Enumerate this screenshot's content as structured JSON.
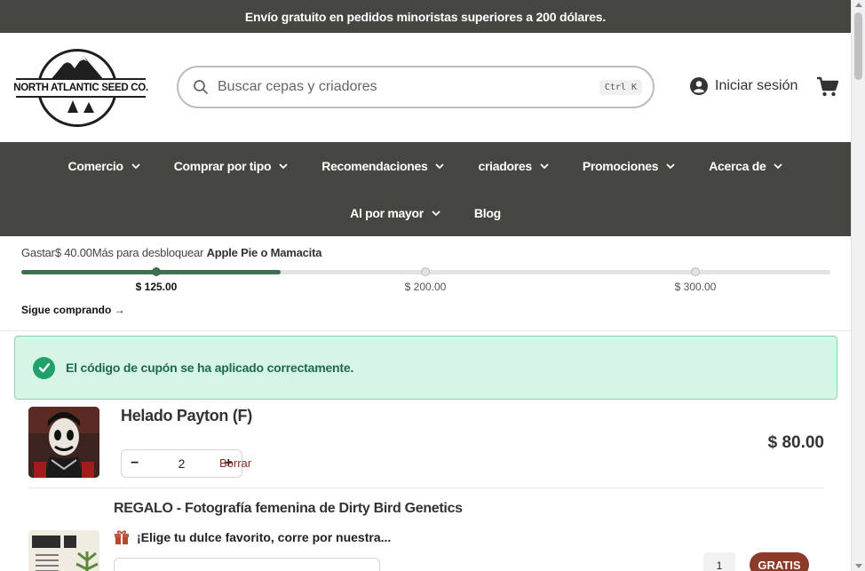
{
  "announcement": "Envío gratuito en pedidos minoristas superiores a 200 dólares.",
  "logo": {
    "text": "NORTH ATLANTIC SEED CO."
  },
  "search": {
    "placeholder": "Buscar cepas y criadores",
    "shortcut": "Ctrl K"
  },
  "account": {
    "login_label": "Iniciar sesión"
  },
  "nav": {
    "row1": [
      {
        "label": "Comercio",
        "has_dropdown": true
      },
      {
        "label": "Comprar por tipo",
        "has_dropdown": true
      },
      {
        "label": "Recomendaciones",
        "has_dropdown": true
      },
      {
        "label": "criadores",
        "has_dropdown": true
      },
      {
        "label": "Promociones",
        "has_dropdown": true
      },
      {
        "label": "Acerca de",
        "has_dropdown": true
      }
    ],
    "row2": [
      {
        "label": "Al por mayor",
        "has_dropdown": true
      },
      {
        "label": "Blog",
        "has_dropdown": false
      }
    ]
  },
  "progress": {
    "message_prefix": "Gastar",
    "message_amount": "$ 40.00",
    "message_mid": "Más para desbloquear",
    "message_reward": "Apple Pie o Mamacita",
    "fill_fraction": 0.32,
    "milestones": [
      "$ 125.00",
      "$ 200.00",
      "$ 300.00"
    ],
    "active_milestone_index": 0,
    "keep_shopping": "Sigue comprando →"
  },
  "alert": {
    "text": "El código de cupón se ha aplicado correctamente.",
    "color": "#20a16a"
  },
  "cart_items": [
    {
      "title": "Helado Payton (F)",
      "quantity": "2",
      "remove_label": "Borrar",
      "price": "$ 80.00"
    },
    {
      "title": "REGALO - Fotografía femenina de Dirty Bird Genetics",
      "description": "¡Elige tu dulce favorito, corre por nuestra...",
      "quantity": "1",
      "badge": "GRATIS"
    }
  ],
  "colors": {
    "nav_bg": "#45463f",
    "progress_fill": "#3e6f4f",
    "badge": "#8c3b28",
    "remove": "#8b2d22"
  }
}
